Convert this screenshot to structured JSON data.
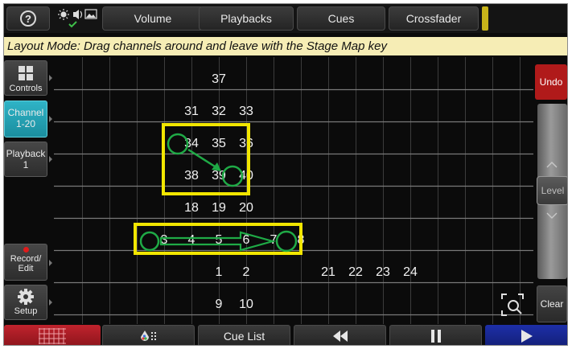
{
  "topbar": {
    "help_label": "?",
    "volume_label": "Volume",
    "playbacks_label": "Playbacks",
    "cues_label": "Cues",
    "crossfader_label": "Crossfader",
    "status_icons": [
      "brightness-icon",
      "speaker-icon",
      "image-icon",
      "check-icon"
    ]
  },
  "message": "Layout Mode: Drag channels around and leave with the Stage Map key",
  "sidebar": {
    "controls_label": "Controls",
    "channel_label": "Channel",
    "channel_range": "1-20",
    "playback_label": "Playback",
    "playback_number": "1",
    "record_label": "Record/",
    "edit_label": "Edit",
    "setup_label": "Setup"
  },
  "channels": [
    {
      "n": "37",
      "col": 5,
      "row": 0
    },
    {
      "n": "31",
      "col": 4,
      "row": 1
    },
    {
      "n": "32",
      "col": 5,
      "row": 1
    },
    {
      "n": "33",
      "col": 6,
      "row": 1
    },
    {
      "n": "34",
      "col": 4,
      "row": 2,
      "circled": true
    },
    {
      "n": "35",
      "col": 5,
      "row": 2
    },
    {
      "n": "36",
      "col": 6,
      "row": 2
    },
    {
      "n": "38",
      "col": 4,
      "row": 3
    },
    {
      "n": "39",
      "col": 5,
      "row": 3
    },
    {
      "n": "40",
      "col": 6,
      "row": 3,
      "circled": true
    },
    {
      "n": "18",
      "col": 4,
      "row": 4
    },
    {
      "n": "19",
      "col": 5,
      "row": 4
    },
    {
      "n": "20",
      "col": 6,
      "row": 4
    },
    {
      "n": "3",
      "col": 3,
      "row": 5,
      "circled": true
    },
    {
      "n": "4",
      "col": 4,
      "row": 5
    },
    {
      "n": "5",
      "col": 5,
      "row": 5
    },
    {
      "n": "6",
      "col": 6,
      "row": 5
    },
    {
      "n": "7",
      "col": 7,
      "row": 5
    },
    {
      "n": "8",
      "col": 8,
      "row": 5,
      "circled": true
    },
    {
      "n": "1",
      "col": 5,
      "row": 6
    },
    {
      "n": "2",
      "col": 6,
      "row": 6
    },
    {
      "n": "21",
      "col": 9,
      "row": 6
    },
    {
      "n": "22",
      "col": 10,
      "row": 6
    },
    {
      "n": "23",
      "col": 11,
      "row": 6
    },
    {
      "n": "24",
      "col": 12,
      "row": 6
    },
    {
      "n": "9",
      "col": 5,
      "row": 7
    },
    {
      "n": "10",
      "col": 6,
      "row": 7
    }
  ],
  "right": {
    "undo_label": "Undo",
    "level_label": "Level",
    "clear_label": "Clear"
  },
  "bottombar": {
    "cue_list_label": "Cue List"
  },
  "colors": {
    "highlight": "#f2e600",
    "annotation": "#1faa46",
    "active": "#21a3b6",
    "undo": "#b01a1a",
    "play": "#1a2a9c"
  }
}
